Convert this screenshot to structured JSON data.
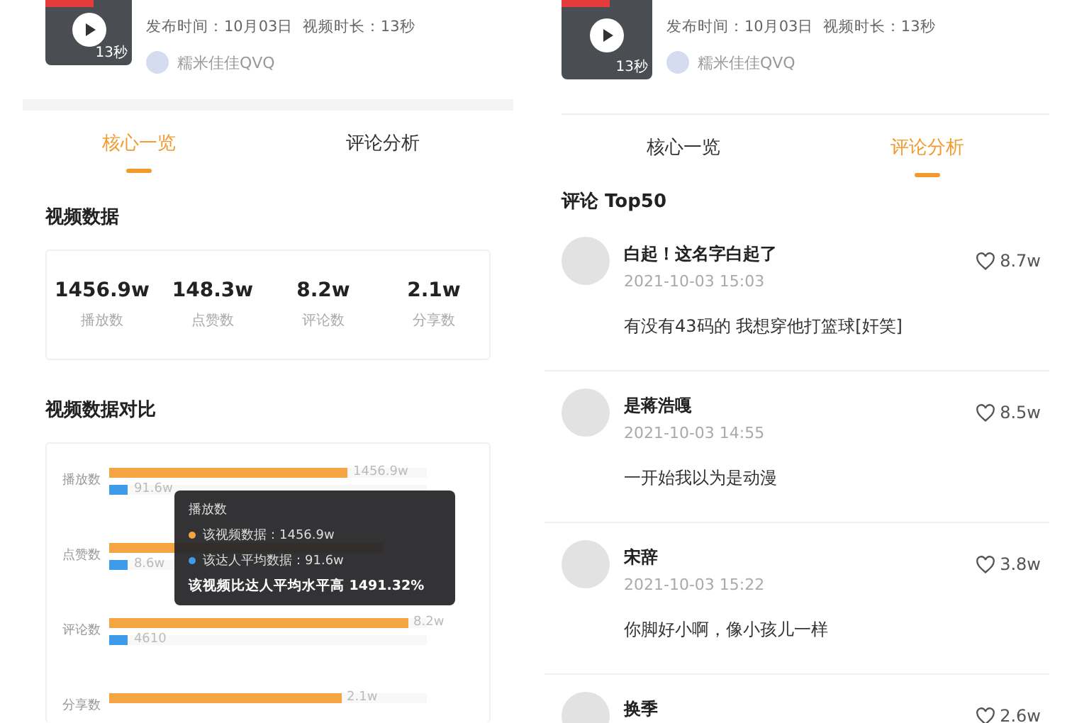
{
  "left": {
    "video": {
      "duration_badge": "13秒",
      "meta": "发布时间：10月03日  视频时长：13秒",
      "author": "糯米佳佳QVQ"
    },
    "tabs": [
      {
        "label": "核心一览",
        "selected": true
      },
      {
        "label": "评论分析",
        "selected": false
      }
    ],
    "video_data": {
      "title": "视频数据",
      "stats": [
        {
          "value": "1456.9w",
          "label": "播放数"
        },
        {
          "value": "148.3w",
          "label": "点赞数"
        },
        {
          "value": "8.2w",
          "label": "评论数"
        },
        {
          "value": "2.1w",
          "label": "分享数"
        }
      ]
    },
    "compare": {
      "title": "视频数据对比",
      "rows": [
        {
          "label": "播放数",
          "video": {
            "level": 0.75,
            "value": "1456.9w"
          },
          "average": {
            "level": 0.06,
            "value": "91.6w"
          }
        },
        {
          "label": "点赞数",
          "video": {
            "level": 0.86
          },
          "average": {
            "level": 0.06,
            "value": "8.6w"
          }
        },
        {
          "label": "评论数",
          "video": {
            "level": 0.94,
            "value": "8.2w"
          },
          "average": {
            "level": 0.06,
            "value": "4610"
          }
        },
        {
          "label": "分享数",
          "video": {
            "level": 0.73,
            "value": "2.1w"
          }
        }
      ],
      "tooltip": {
        "title": "播放数",
        "items": [
          {
            "label": "该视频数据：1456.9w",
            "color": "#f5a442"
          },
          {
            "label": "该达人平均数据：91.6w",
            "color": "#3d9be9"
          }
        ],
        "summary": "该视频比达人平均水平高 1491.32%"
      }
    }
  },
  "right": {
    "video": {
      "duration_badge": "13秒",
      "meta": "发布时间：10月03日  视频时长：13秒",
      "author": "糯米佳佳QVQ"
    },
    "tabs": [
      {
        "label": "核心一览",
        "selected": false
      },
      {
        "label": "评论分析",
        "selected": true
      }
    ],
    "comments_title": "评论 Top50",
    "comments": [
      {
        "name": "白起！这名字白起了",
        "time": "2021-10-03 15:03",
        "text": "有没有43码的 我想穿他打篮球[奸笑]",
        "likes": "8.7w"
      },
      {
        "name": "是蒋浩嘎",
        "time": "2021-10-03 14:55",
        "text": "一开始我以为是动漫",
        "likes": "8.5w"
      },
      {
        "name": "宋辞",
        "time": "2021-10-03 15:22",
        "text": "你脚好小啊，像小孩儿一样",
        "likes": "3.8w"
      },
      {
        "name": "换季",
        "likes": "2.6w"
      }
    ]
  }
}
